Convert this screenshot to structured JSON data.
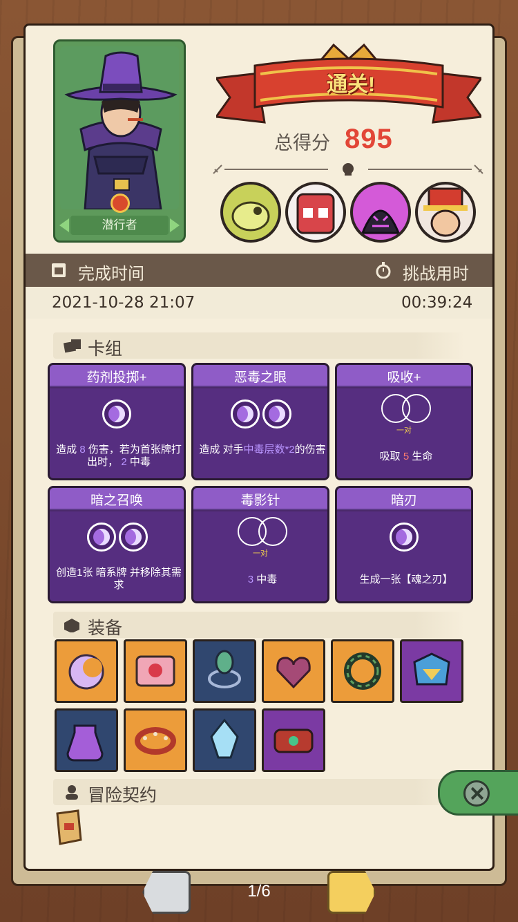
{
  "character": {
    "name": "潜行者"
  },
  "result": {
    "banner": "通关!",
    "score_label": "总得分",
    "score_value": "895"
  },
  "bosses": [
    {
      "name": "boss-lizard-skull",
      "color": "#c8d15a"
    },
    {
      "name": "boss-red-mask",
      "color": "#d8454a"
    },
    {
      "name": "boss-dark-monster",
      "color": "#3a2c4a"
    },
    {
      "name": "boss-clown-hat",
      "color": "#e14a3a"
    }
  ],
  "time": {
    "finish_label": "完成时间",
    "finish_value": "2021-10-28 21:07",
    "duration_label": "挑战用时",
    "duration_value": "00:39:24"
  },
  "deck": {
    "title": "卡组",
    "cards": [
      {
        "title": "药剂投掷+",
        "text_a": "造成 ",
        "num1": "8",
        "text_b": " 伤害，若为首张牌打出时， ",
        "num2": "2",
        "text_c": " 中毒"
      },
      {
        "title": "恶毒之眼",
        "text_a": "造成 对手",
        "hl": "中毒层数*2",
        "text_b": "的伤害"
      },
      {
        "title": "吸收+",
        "pair": "一对",
        "text_a": "吸取 ",
        "num1": "5",
        "text_b": " 生命"
      },
      {
        "title": "暗之召唤",
        "text_a": "创造1张 ",
        "text_b": "暗系牌 并移除其需求"
      },
      {
        "title": "毒影针",
        "pair": "一对",
        "num1": "3",
        "text_b": " 中毒"
      },
      {
        "title": "暗刃",
        "text_a": "生成一张【魂之刃】"
      }
    ]
  },
  "equipment": {
    "title": "装备",
    "items": [
      {
        "name": "moon-charm-icon",
        "bg": "orange"
      },
      {
        "name": "heart-box-icon",
        "bg": "orange"
      },
      {
        "name": "leaf-ring-icon",
        "bg": "blue"
      },
      {
        "name": "thorn-heart-icon",
        "bg": "orange"
      },
      {
        "name": "serpent-ring-icon",
        "bg": "orange"
      },
      {
        "name": "crystal-helm-icon",
        "bg": "purple"
      },
      {
        "name": "potion-jug-icon",
        "bg": "blue"
      },
      {
        "name": "spike-collar-icon",
        "bg": "orange"
      },
      {
        "name": "ice-crystal-icon",
        "bg": "blue"
      },
      {
        "name": "red-bracer-icon",
        "bg": "purple"
      }
    ]
  },
  "contract": {
    "title": "冒险契约"
  },
  "pager": {
    "page": "1/6"
  },
  "colors": {
    "accent_purple": "#8f5cc7",
    "score_red": "#e24637",
    "banner_red": "#d8412f"
  }
}
